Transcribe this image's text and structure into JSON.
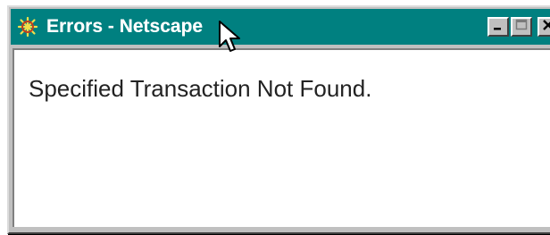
{
  "window": {
    "title": "Errors - Netscape",
    "app_icon": "netscape-wheel-icon",
    "controls": {
      "minimize": "minimize-icon",
      "maximize": "maximize-icon",
      "close": "close-icon"
    }
  },
  "content": {
    "message": "Specified Transaction Not Found."
  },
  "colors": {
    "titlebar": "#008080",
    "chrome": "#c0c0c0",
    "content_bg": "#ffffff",
    "text": "#222222"
  }
}
